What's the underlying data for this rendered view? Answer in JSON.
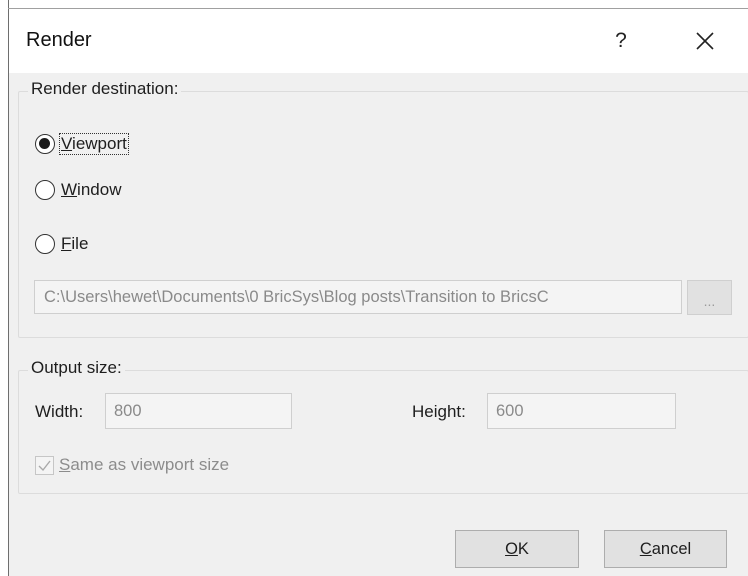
{
  "dialog": {
    "title": "Render",
    "help_label": "?",
    "close_icon": "close-icon"
  },
  "render_destination": {
    "legend": "Render destination:",
    "options": [
      {
        "mnemonic": "V",
        "rest": "iewport",
        "checked": true
      },
      {
        "mnemonic": "W",
        "rest": "indow",
        "checked": false
      },
      {
        "mnemonic": "F",
        "rest": "ile",
        "checked": false
      }
    ],
    "file_path": "C:\\Users\\hewet\\Documents\\0 BricSys\\Blog posts\\Transition to BricsC",
    "browse_label": "..."
  },
  "output_size": {
    "legend": "Output size:",
    "width_label": "Width:",
    "width_value": "800",
    "height_label": "Height:",
    "height_value": "600",
    "same_as_viewport": {
      "mnemonic": "S",
      "rest": "ame as viewport size",
      "checked": true,
      "enabled": false
    }
  },
  "buttons": {
    "ok": {
      "mnemonic": "O",
      "rest": "K"
    },
    "cancel": {
      "mnemonic": "C",
      "rest": "ancel"
    }
  }
}
